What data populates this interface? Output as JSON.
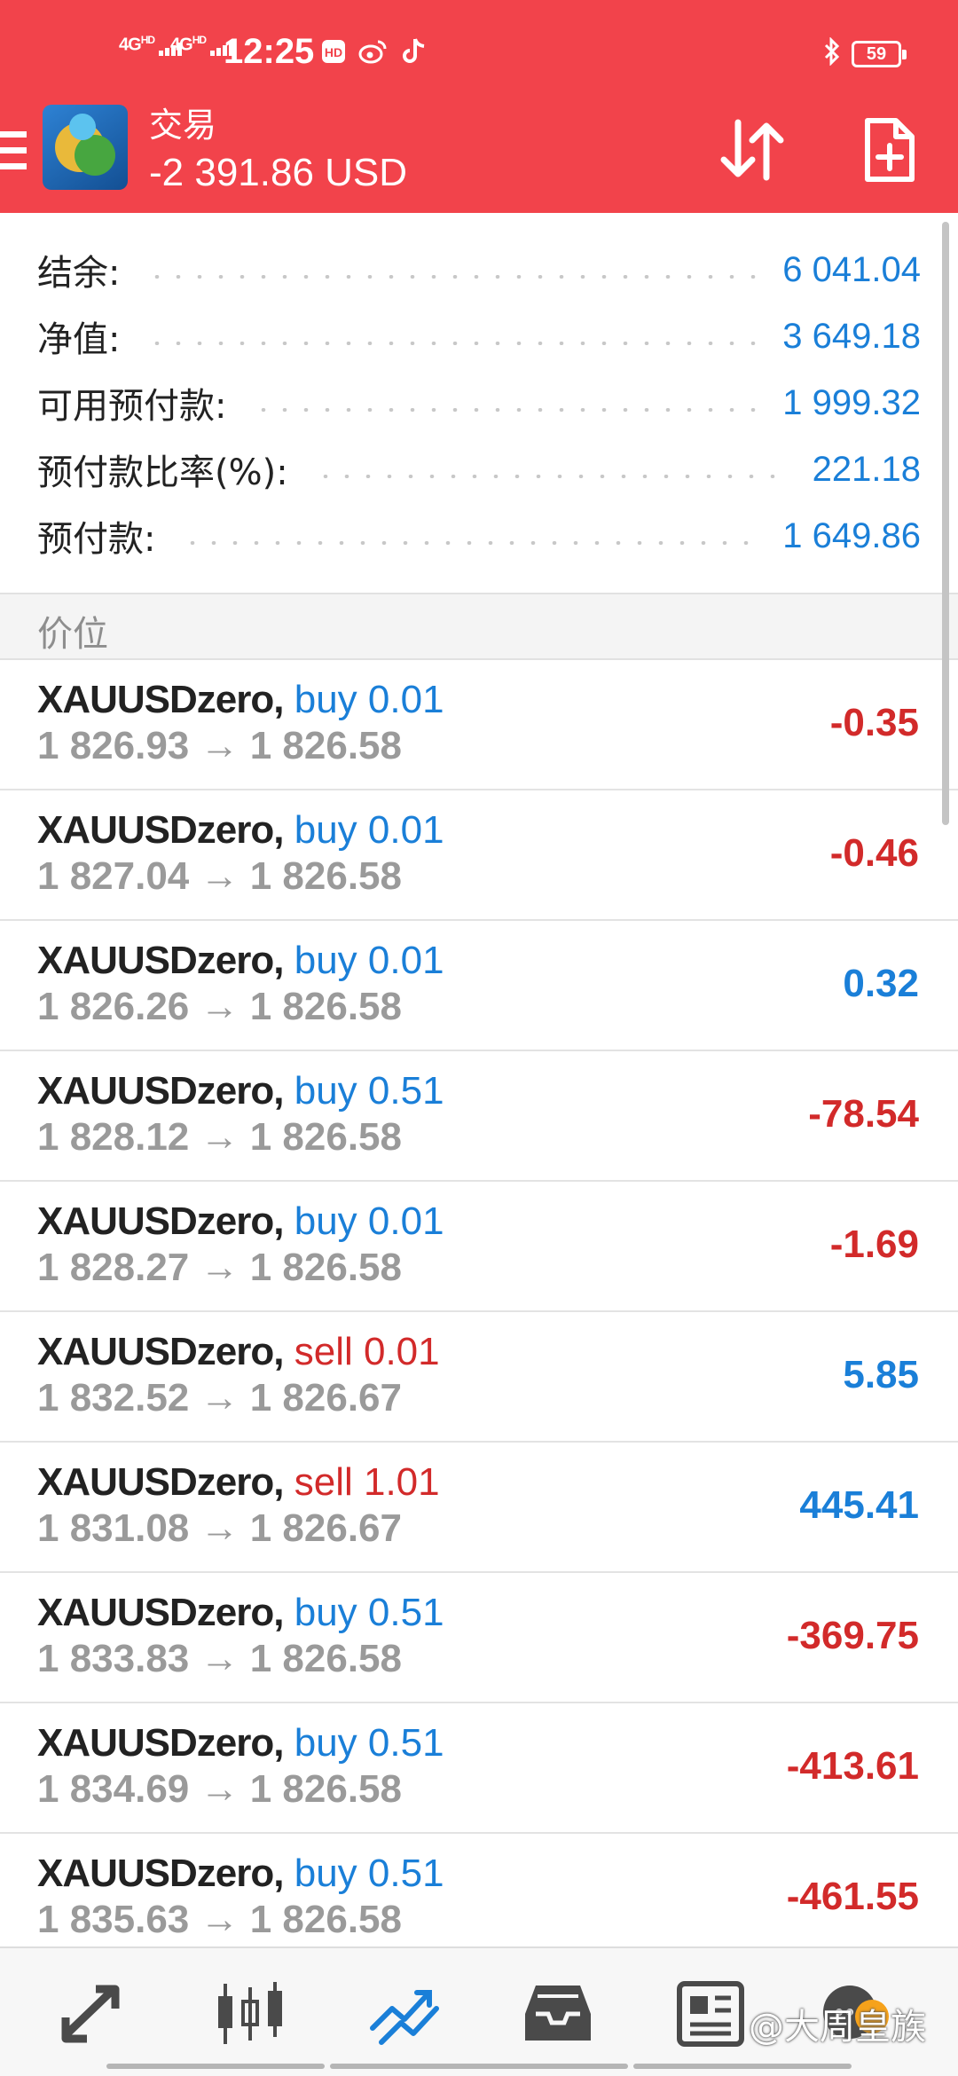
{
  "status_bar": {
    "signal1": "4G",
    "signal1_sup": "HD",
    "signal2": "4G",
    "signal2_sup": "HD",
    "time": "12:25",
    "battery": "59",
    "icons": [
      "hd-voice-icon",
      "weibo-icon",
      "tiktok-icon",
      "bluetooth-icon"
    ]
  },
  "header": {
    "title": "交易",
    "balance_text": "-2 391.86 USD",
    "icons": [
      "menu-icon",
      "app-logo",
      "sort-icon",
      "new-order-icon"
    ]
  },
  "summary": [
    {
      "label": "结余:",
      "value": "6 041.04"
    },
    {
      "label": "净值:",
      "value": "3 649.18"
    },
    {
      "label": "可用预付款:",
      "value": "1 999.32"
    },
    {
      "label": "预付款比率(%):",
      "value": "221.18"
    },
    {
      "label": "预付款:",
      "value": "1 649.86"
    }
  ],
  "section_title": "价位",
  "positions": [
    {
      "symbol": "XAUUSDzero,",
      "type": "buy 0.01",
      "side": "buy",
      "prices": "1 826.93 → 1 826.58",
      "profit": "-0.35",
      "sign": "neg"
    },
    {
      "symbol": "XAUUSDzero,",
      "type": "buy 0.01",
      "side": "buy",
      "prices": "1 827.04 → 1 826.58",
      "profit": "-0.46",
      "sign": "neg"
    },
    {
      "symbol": "XAUUSDzero,",
      "type": "buy 0.01",
      "side": "buy",
      "prices": "1 826.26 → 1 826.58",
      "profit": "0.32",
      "sign": "pos"
    },
    {
      "symbol": "XAUUSDzero,",
      "type": "buy 0.51",
      "side": "buy",
      "prices": "1 828.12 → 1 826.58",
      "profit": "-78.54",
      "sign": "neg"
    },
    {
      "symbol": "XAUUSDzero,",
      "type": "buy 0.01",
      "side": "buy",
      "prices": "1 828.27 → 1 826.58",
      "profit": "-1.69",
      "sign": "neg"
    },
    {
      "symbol": "XAUUSDzero,",
      "type": "sell 0.01",
      "side": "sell",
      "prices": "1 832.52 → 1 826.67",
      "profit": "5.85",
      "sign": "pos"
    },
    {
      "symbol": "XAUUSDzero,",
      "type": "sell 1.01",
      "side": "sell",
      "prices": "1 831.08 → 1 826.67",
      "profit": "445.41",
      "sign": "pos"
    },
    {
      "symbol": "XAUUSDzero,",
      "type": "buy 0.51",
      "side": "buy",
      "prices": "1 833.83 → 1 826.58",
      "profit": "-369.75",
      "sign": "neg"
    },
    {
      "symbol": "XAUUSDzero,",
      "type": "buy 0.51",
      "side": "buy",
      "prices": "1 834.69 → 1 826.58",
      "profit": "-413.61",
      "sign": "neg"
    },
    {
      "symbol": "XAUUSDzero,",
      "type": "buy 0.51",
      "side": "buy",
      "prices": "1 835.63 → 1 826.58",
      "profit": "-461.55",
      "sign": "neg"
    }
  ],
  "bottom_nav": {
    "items": [
      "quotes-icon",
      "chart-icon",
      "trade-icon",
      "history-icon",
      "news-icon",
      "messages-icon"
    ],
    "active": "trade-icon",
    "active_color": "#1a7fd8",
    "inactive_color": "#4a4a4a"
  },
  "watermark": "@大周皇族",
  "colors": {
    "header_bg": "#f2434b",
    "value_blue": "#1a7fd8",
    "loss_red": "#d22a2a",
    "muted_gray": "#9a9a9a"
  }
}
